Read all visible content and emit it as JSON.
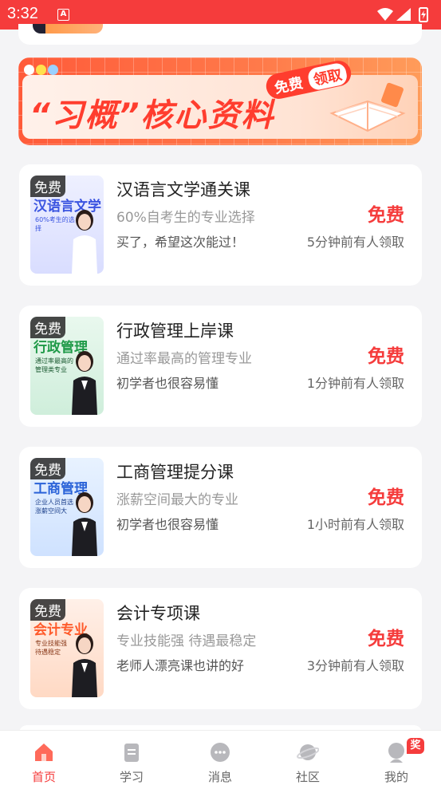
{
  "status_bar": {
    "time": "3:32",
    "notification_letter": "A"
  },
  "banner": {
    "title": "“习概”核心资料",
    "badge_left": "免费",
    "badge_right": "领取",
    "dot_colors": [
      "#ffffff",
      "#ffe14d",
      "#9ad0ff"
    ]
  },
  "courses": [
    {
      "tag": "免费",
      "thumb_title": "汉语言文学",
      "thumb_sub": "60%考生的选择",
      "title": "汉语言文学通关课",
      "desc": "60%自考生的专业选择",
      "comment": "买了，希望这次能过！",
      "price": "免费",
      "time": "5分钟前有人领取",
      "theme": "#e9eaff",
      "theme_accent": "#3a54e0"
    },
    {
      "tag": "免费",
      "thumb_title": "行政管理",
      "thumb_sub": "通过率最高的管理类专业",
      "title": "行政管理上岸课",
      "desc": "通过率最高的管理专业",
      "comment": "初学者也很容易懂",
      "price": "免费",
      "time": "1分钟前有人领取",
      "theme": "#e3f6e8",
      "theme_accent": "#1f9a48"
    },
    {
      "tag": "免费",
      "thumb_title": "工商管理",
      "thumb_sub": "企业人员首选 涨薪空间大",
      "title": "工商管理提分课",
      "desc": "涨薪空间最大的专业",
      "comment": "初学者也很容易懂",
      "price": "免费",
      "time": "1小时前有人领取",
      "theme": "#e4f0ff",
      "theme_accent": "#2a63d8"
    },
    {
      "tag": "免费",
      "thumb_title": "会计专业",
      "thumb_sub": "专业技能强 待遇稳定",
      "title": "会计专项课",
      "desc": "专业技能强 待遇最稳定",
      "comment": "老师人漂亮课也讲的好",
      "price": "免费",
      "time": "3分钟前有人领取",
      "theme": "#ffe8dc",
      "theme_accent": "#ff5a2a"
    }
  ],
  "tabbar": {
    "tabs": [
      {
        "label": "首页",
        "icon": "home-icon",
        "active": true
      },
      {
        "label": "学习",
        "icon": "book-icon",
        "active": false
      },
      {
        "label": "消息",
        "icon": "message-icon",
        "active": false
      },
      {
        "label": "社区",
        "icon": "planet-icon",
        "active": false
      },
      {
        "label": "我的",
        "icon": "user-icon",
        "active": false
      }
    ],
    "prize_badge": "奖"
  }
}
